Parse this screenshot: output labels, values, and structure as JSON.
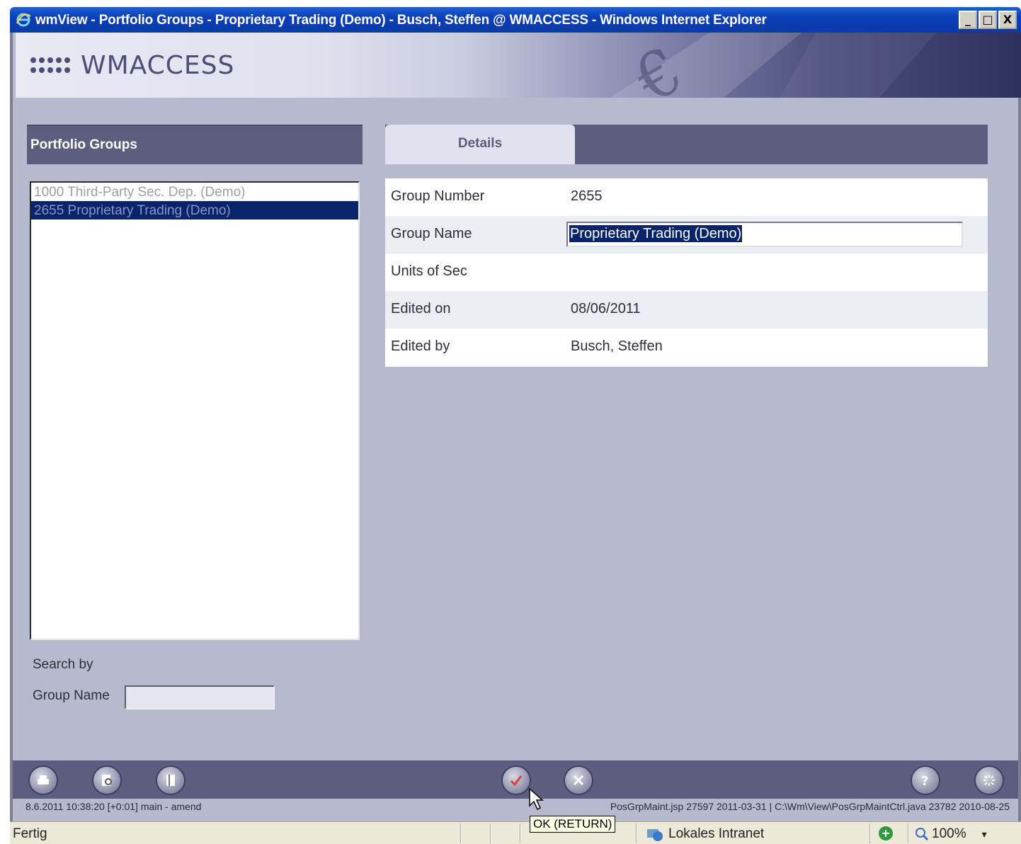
{
  "window": {
    "title": "wmView - Portfolio Groups - Proprietary Trading (Demo) - Busch, Steffen @ WMACCESS - Windows Internet Explorer",
    "minimize": "_",
    "maximize": "□",
    "close": "X"
  },
  "brand": "WMACCESS",
  "left_panel": {
    "title": "Portfolio Groups",
    "items": [
      {
        "label": "1000 Third-Party Sec. Dep. (Demo)",
        "selected": false
      },
      {
        "label": "2655 Proprietary Trading (Demo)",
        "selected": true
      }
    ],
    "search_by": "Search by",
    "group_name_label": "Group Name",
    "group_name_value": ""
  },
  "right_panel": {
    "tab": "Details",
    "fields": [
      {
        "label": "Group Number",
        "value": "2655"
      },
      {
        "label": "Group Name",
        "value": "Proprietary Trading (Demo)"
      },
      {
        "label": "Units of Sec",
        "value": ""
      },
      {
        "label": "Edited on",
        "value": "08/06/2011"
      },
      {
        "label": "Edited by",
        "value": "Busch, Steffen"
      }
    ]
  },
  "toolbar": {
    "buttons": [
      "print-icon",
      "preview-icon",
      "book-icon",
      "ok-check-icon",
      "cancel-x-icon",
      "help-icon",
      "settings-icon"
    ],
    "tooltip": "OK (RETURN)"
  },
  "status_line": {
    "left": "8.6.2011 10:38:20 [+0:01] main - amend",
    "right": "PosGrpMaint.jsp 27597 2011-03-31  |  C:\\Wm\\View\\PosGrpMaintCtrl.java 23782 2010-08-25"
  },
  "ie_status": {
    "text": "Fertig",
    "zone": "Lokales Intranet",
    "zoom": "100%"
  },
  "colors": {
    "panel_header": "#5c5e80",
    "background": "#b6bace",
    "selection": "#0a246a"
  }
}
